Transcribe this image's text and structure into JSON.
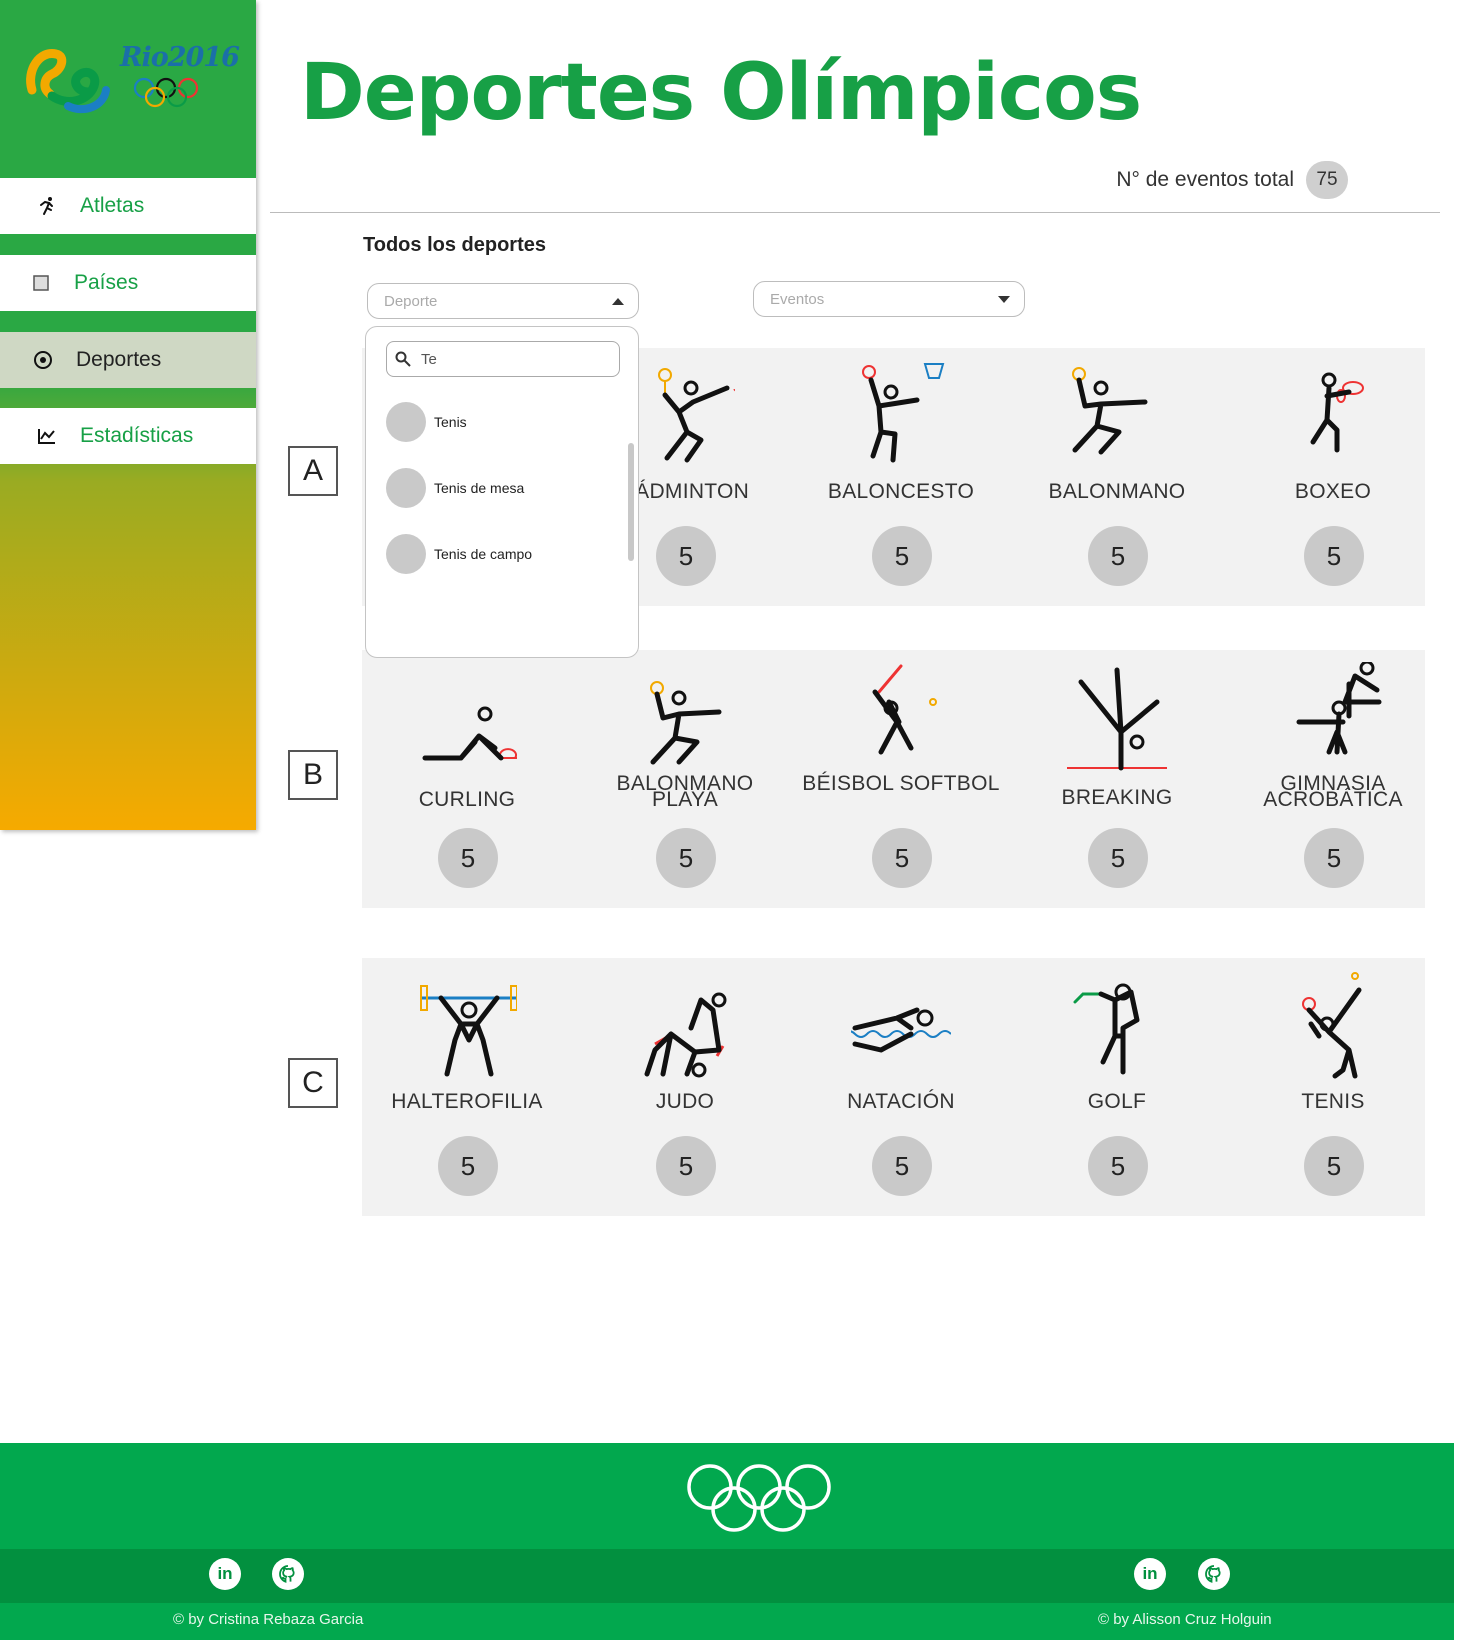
{
  "brand": {
    "logo_text": "Rio2016"
  },
  "nav": [
    {
      "label": "Atletas",
      "icon": "running-icon"
    },
    {
      "label": "Países",
      "icon": "square-icon"
    },
    {
      "label": "Deportes",
      "icon": "soccer-ball-icon",
      "active": true
    },
    {
      "label": "Estadísticas",
      "icon": "chart-icon"
    }
  ],
  "header": {
    "title": "Deportes Olímpicos",
    "events_total_label": "N° de eventos total",
    "events_total_value": "75"
  },
  "filters": {
    "section_label": "Todos los deportes",
    "sport_placeholder": "Deporte",
    "events_placeholder": "Eventos"
  },
  "dropdown": {
    "search_value": "Te",
    "options": [
      "Tenis",
      "Tenis de mesa",
      "Tenis de campo"
    ]
  },
  "rows": [
    {
      "letter": "A",
      "sports": [
        {
          "name": "BÁDMINTON",
          "count": "5",
          "icon": "badminton-icon"
        },
        {
          "name": "BALONCESTO",
          "count": "5",
          "icon": "basketball-icon"
        },
        {
          "name": "BALONMANO",
          "count": "5",
          "icon": "handball-icon"
        },
        {
          "name": "BOXEO",
          "count": "5",
          "icon": "boxing-icon"
        }
      ]
    },
    {
      "letter": "B",
      "sports": [
        {
          "name": "CURLING",
          "count": "5",
          "icon": "curling-icon"
        },
        {
          "name": "BALONMANO PLAYA",
          "count": "5",
          "icon": "beach-handball-icon"
        },
        {
          "name": "BÉISBOL SOFTBOL",
          "count": "5",
          "icon": "baseball-icon"
        },
        {
          "name": "BREAKING",
          "count": "5",
          "icon": "breaking-icon"
        },
        {
          "name": "GIMNASIA ACROBÁTICA",
          "count": "5",
          "icon": "acrobatic-gymnastics-icon"
        }
      ]
    },
    {
      "letter": "C",
      "sports": [
        {
          "name": "HALTEROFILIA",
          "count": "5",
          "icon": "weightlifting-icon"
        },
        {
          "name": "JUDO",
          "count": "5",
          "icon": "judo-icon"
        },
        {
          "name": "NATACIÓN",
          "count": "5",
          "icon": "swimming-icon"
        },
        {
          "name": "GOLF",
          "count": "5",
          "icon": "golf-icon"
        },
        {
          "name": "TENIS",
          "count": "5",
          "icon": "tennis-icon"
        }
      ]
    }
  ],
  "footer": {
    "left_credit": "© by Cristina Rebaza Garcia",
    "right_credit": "© by Alisson Cruz Holguin",
    "social_icons": [
      "linkedin-icon",
      "github-icon"
    ]
  }
}
